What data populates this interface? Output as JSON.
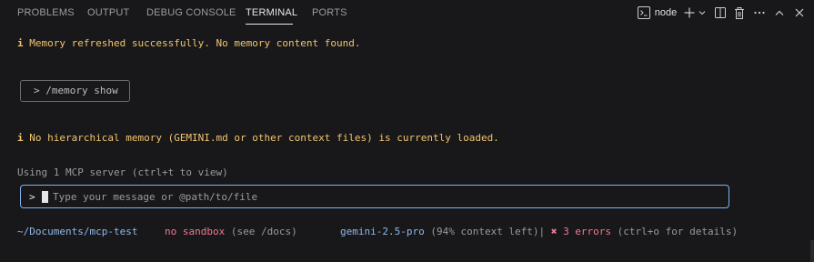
{
  "panel": {
    "tabs": [
      {
        "label": "PROBLEMS"
      },
      {
        "label": "OUTPUT"
      },
      {
        "label": "DEBUG CONSOLE"
      },
      {
        "label": "TERMINAL",
        "active": true
      },
      {
        "label": "PORTS"
      }
    ],
    "terminal_name": "node",
    "icons": [
      "terminal-icon",
      "plus-icon",
      "chevron-down-icon",
      "split-icon",
      "trash-icon",
      "more-icon",
      "chevron-up-icon",
      "close-icon"
    ]
  },
  "terminal": {
    "info_glyph": "i",
    "memory_refreshed": "Memory refreshed successfully. No memory content found.",
    "command": "> /memory show",
    "no_memory": "No hierarchical memory (GEMINI.md or other context files) is currently loaded.",
    "mcp_status": "Using 1 MCP server (ctrl+t to view)",
    "input_prompt": ">",
    "input_placeholder": "Type your message or @path/to/file"
  },
  "status_bar": {
    "path": "~/Documents/mcp-test",
    "sandbox": "no sandbox",
    "sandbox_hint": "(see /docs)",
    "model": "gemini-2.5-pro",
    "context": "(94% context left)|",
    "error_mark": "✖",
    "errors": "3 errors",
    "errors_hint": "(ctrl+o for details)"
  },
  "colors": {
    "background": "#18181a",
    "info": "#f2c46d",
    "accent_blue": "#8fb8e8",
    "error_pink": "#f07892",
    "input_border": "#7fb2f0"
  }
}
